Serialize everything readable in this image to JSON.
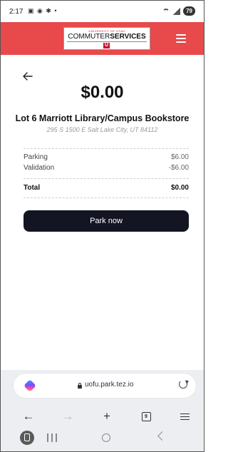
{
  "status_bar": {
    "time": "2:17",
    "battery": "79"
  },
  "header": {
    "logo_small": "UNIVERSITY OF UTAH",
    "logo_main_light": "COMMUTER",
    "logo_main_bold": "SERVICES",
    "logo_mark": "U"
  },
  "summary": {
    "amount": "$0.00",
    "lot_name": "Lot 6 Marriott Library/Campus Bookstore",
    "address": "295 S 1500 E Salt Lake City, UT 84112"
  },
  "line_items": [
    {
      "label": "Parking",
      "value": "$6.00"
    },
    {
      "label": "Validation",
      "value": "-$6.00"
    }
  ],
  "total": {
    "label": "Total",
    "value": "$0.00"
  },
  "park_button": {
    "label": "Park now"
  },
  "browser": {
    "url": "uofu.park.tez.io",
    "tab_count": "9"
  }
}
